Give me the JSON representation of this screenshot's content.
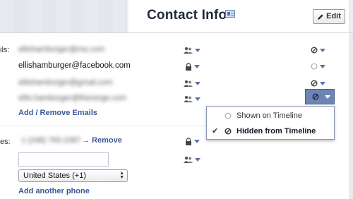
{
  "header": {
    "title": "Contact Info",
    "edit_label": "Edit"
  },
  "emails": {
    "section_label_visible": "ils:",
    "items": [
      {
        "address": "ellishamburger@me.com",
        "blurred": true,
        "audience_icon": "friends-icon",
        "timeline_icon": "hidden-circle-icon"
      },
      {
        "address": "ellishamburger@facebook.com",
        "blurred": false,
        "audience_icon": "lock-icon",
        "timeline_icon": "shown-circle-icon"
      },
      {
        "address": "ellishamburger@gmail.com",
        "blurred": true,
        "audience_icon": "friends-icon",
        "timeline_icon": "hidden-circle-icon"
      },
      {
        "address": "ellis.hamburger@theverge.com",
        "blurred": true,
        "audience_icon": "friends-icon",
        "timeline_icon": "hidden-circle-icon"
      }
    ],
    "add_remove_label": "Add / Remove Emails"
  },
  "timeline_menu": {
    "options": [
      {
        "label": "Shown on Timeline",
        "checked": false
      },
      {
        "label": "Hidden from Timeline",
        "checked": true
      }
    ]
  },
  "phones": {
    "section_label_visible": "es:",
    "number": "1 (248) 765-2387",
    "remove_label": "→ Remove",
    "new_number_value": "",
    "country_selected": "United States (+1)",
    "add_another_label": "Add another phone"
  },
  "colors": {
    "link": "#3b5998",
    "caret": "#5b73a6",
    "active_dropdown": "#6d84b4"
  }
}
